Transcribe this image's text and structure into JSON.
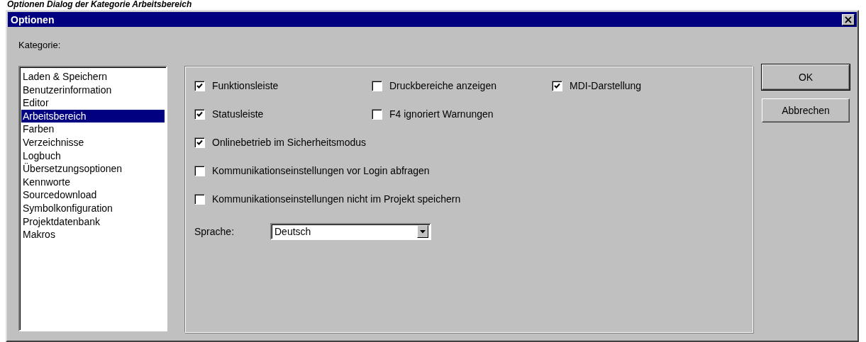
{
  "caption": "Optionen Dialog der Kategorie Arbeitsbereich",
  "window": {
    "title": "Optionen",
    "close": "×"
  },
  "category_label": "Kategorie:",
  "categories": [
    {
      "label": "Laden & Speichern",
      "selected": false
    },
    {
      "label": "Benutzerinformation",
      "selected": false
    },
    {
      "label": "Editor",
      "selected": false
    },
    {
      "label": "Arbeitsbereich",
      "selected": true
    },
    {
      "label": "Farben",
      "selected": false
    },
    {
      "label": "Verzeichnisse",
      "selected": false
    },
    {
      "label": "Logbuch",
      "selected": false
    },
    {
      "label": "Übersetzungsoptionen",
      "selected": false
    },
    {
      "label": "Kennworte",
      "selected": false
    },
    {
      "label": "Sourcedownload",
      "selected": false
    },
    {
      "label": "Symbolkonfiguration",
      "selected": false
    },
    {
      "label": "Projektdatenbank",
      "selected": false
    },
    {
      "label": "Makros",
      "selected": false
    }
  ],
  "checkbox_rows": [
    [
      {
        "label": "Funktionsleiste",
        "checked": true
      },
      {
        "label": "Druckbereiche anzeigen",
        "checked": false
      },
      {
        "label": "MDI-Darstellung",
        "checked": true
      }
    ],
    [
      {
        "label": "Statusleiste",
        "checked": true
      },
      {
        "label": "F4 ignoriert Warnungen",
        "checked": false
      }
    ],
    [
      {
        "label": "Onlinebetrieb im Sicherheitsmodus",
        "checked": true
      }
    ],
    [
      {
        "label": "Kommunikationseinstellungen vor Login abfragen",
        "checked": false
      }
    ],
    [
      {
        "label": "Kommunikationseinstellungen nicht im Projekt speichern",
        "checked": false
      }
    ]
  ],
  "language": {
    "label": "Sprache:",
    "value": "Deutsch"
  },
  "buttons": [
    {
      "label": "OK",
      "default": true
    },
    {
      "label": "Abbrechen",
      "default": false
    }
  ]
}
